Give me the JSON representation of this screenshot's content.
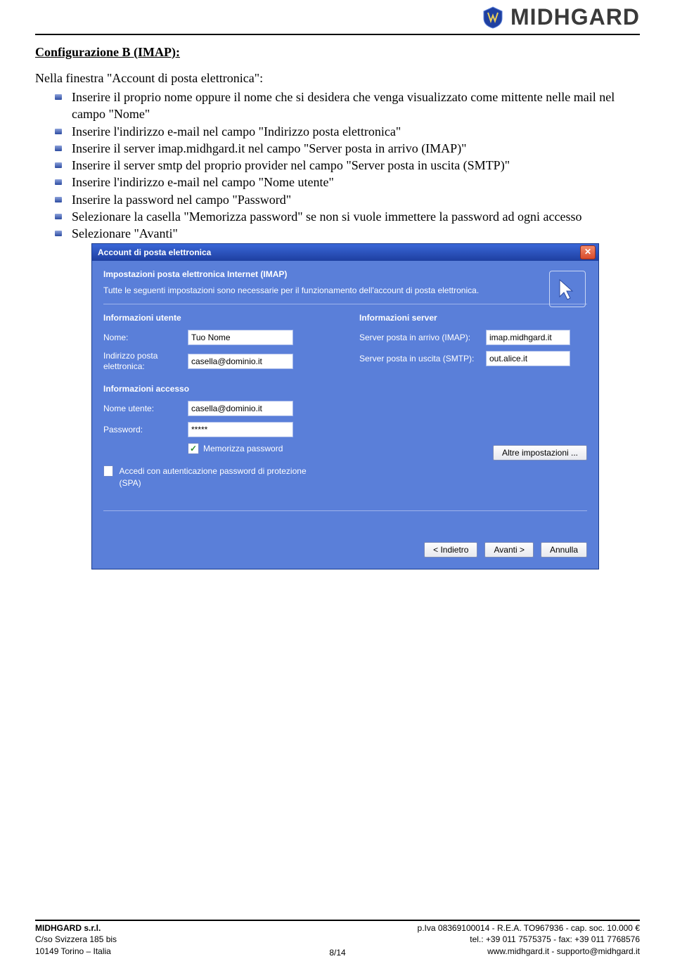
{
  "header": {
    "brand": "MIDHGARD"
  },
  "doc": {
    "title": "Configurazione B (IMAP):",
    "intro": "Nella finestra \"Account di posta elettronica\":",
    "bullets": [
      "Inserire il proprio nome oppure il nome che si desidera che venga visualizzato come mittente nelle mail nel campo \"Nome\"",
      "Inserire l'indirizzo e-mail nel campo \"Indirizzo posta elettronica\"",
      "Inserire il server imap.midhgard.it nel campo \"Server posta in arrivo (IMAP)\"",
      "Inserire il server smtp del proprio provider nel campo \"Server posta in uscita (SMTP)\"",
      "Inserire l'indirizzo e-mail nel campo \"Nome utente\"",
      "Inserire la password nel campo \"Password\"",
      "Selezionare la casella \"Memorizza password\" se non si vuole immettere la password ad ogni accesso",
      "Selezionare \"Avanti\""
    ]
  },
  "dialog": {
    "title": "Account di posta elettronica",
    "heading": "Impostazioni posta elettronica Internet (IMAP)",
    "desc": "Tutte le seguenti impostazioni sono necessarie per il funzionamento dell'account di posta elettronica.",
    "user_section": "Informazioni utente",
    "server_section": "Informazioni server",
    "access_section": "Informazioni accesso",
    "labels": {
      "name": "Nome:",
      "email": "Indirizzo posta elettronica:",
      "incoming": "Server posta in arrivo (IMAP):",
      "outgoing": "Server posta in uscita (SMTP):",
      "username": "Nome utente:",
      "password": "Password:",
      "remember": "Memorizza password",
      "spa": "Accedi con autenticazione password di protezione (SPA)"
    },
    "values": {
      "name": "Tuo Nome",
      "email": "casella@dominio.it",
      "incoming": "imap.midhgard.it",
      "outgoing": "out.alice.it",
      "username": "casella@dominio.it",
      "password": "*****"
    },
    "remember_checked": "✓",
    "buttons": {
      "more": "Altre impostazioni ...",
      "back": "< Indietro",
      "next": "Avanti >",
      "cancel": "Annulla"
    }
  },
  "footer": {
    "company": "MIDHGARD s.r.l.",
    "addr1": "C/so Svizzera 185 bis",
    "addr2": "10149 Torino – Italia",
    "page": "8/14",
    "piva": "p.Iva 08369100014 - R.E.A. TO967936 - cap. soc. 10.000 €",
    "tel": "tel.: +39 011 7575375 - fax: +39 011 7768576",
    "web": "www.midhgard.it - supporto@midhgard.it"
  }
}
